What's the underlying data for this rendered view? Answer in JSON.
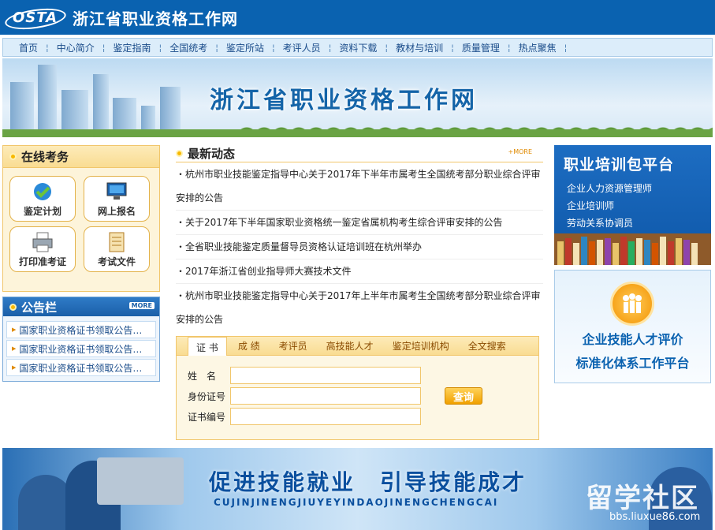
{
  "header": {
    "logo_text": "OSTA",
    "site_title": "浙江省职业资格工作网"
  },
  "nav": {
    "items": [
      "首页",
      "中心简介",
      "鉴定指南",
      "全国统考",
      "鉴定所站",
      "考评人员",
      "资料下载",
      "教材与培训",
      "质量管理",
      "热点聚焦"
    ]
  },
  "banner": {
    "title": "浙江省职业资格工作网"
  },
  "online_exam": {
    "title": "在线考务",
    "services": [
      {
        "label": "鉴定计划",
        "icon": "plan-icon"
      },
      {
        "label": "网上报名",
        "icon": "monitor-icon"
      },
      {
        "label": "打印准考证",
        "icon": "printer-icon"
      },
      {
        "label": "考试文件",
        "icon": "document-icon"
      }
    ]
  },
  "notice_board": {
    "title": "公告栏",
    "more": "MORE",
    "items": [
      "国家职业资格证书领取公告…",
      "国家职业资格证书领取公告…",
      "国家职业资格证书领取公告…"
    ]
  },
  "news": {
    "title": "最新动态",
    "more": "+MORE",
    "items": [
      "・杭州市职业技能鉴定指导中心关于2017年下半年市属考生全国统考部分职业综合评审安排的公告",
      "・关于2017年下半年国家职业资格统一鉴定省属机构考生综合评审安排的公告",
      "・全省职业技能鉴定质量督导员资格认证培训班在杭州举办",
      "・2017年浙江省创业指导师大赛技术文件",
      "・杭州市职业技能鉴定指导中心关于2017年上半年市属考生全国统考部分职业综合评审安排的公告"
    ]
  },
  "query": {
    "tabs": [
      "证 书",
      "成 绩",
      "考评员",
      "高技能人才",
      "鉴定培训机构",
      "全文搜索"
    ],
    "fields": [
      {
        "label": "姓　名",
        "value": ""
      },
      {
        "label": "身份证号",
        "value": ""
      },
      {
        "label": "证书编号",
        "value": ""
      }
    ],
    "button": "查询"
  },
  "training": {
    "title": "职业培训包平台",
    "items": [
      "企业人力资源管理师",
      "企业培训师",
      "劳动关系协调员"
    ]
  },
  "platform": {
    "line1": "企业技能人才评价",
    "line2": "标准化体系工作平台"
  },
  "footer_banner": {
    "title": "促进技能就业　引导技能成才",
    "subtitle": "CUJINJINENGJIUYEYINDAOJINENGCHENGCAI",
    "watermark": "留学社区",
    "watermark_url": "bbs.liuxue86.com"
  },
  "colors": {
    "brand_blue": "#0a62b0",
    "accent_gold": "#f1c66b",
    "button_orange": "#f0a000"
  }
}
